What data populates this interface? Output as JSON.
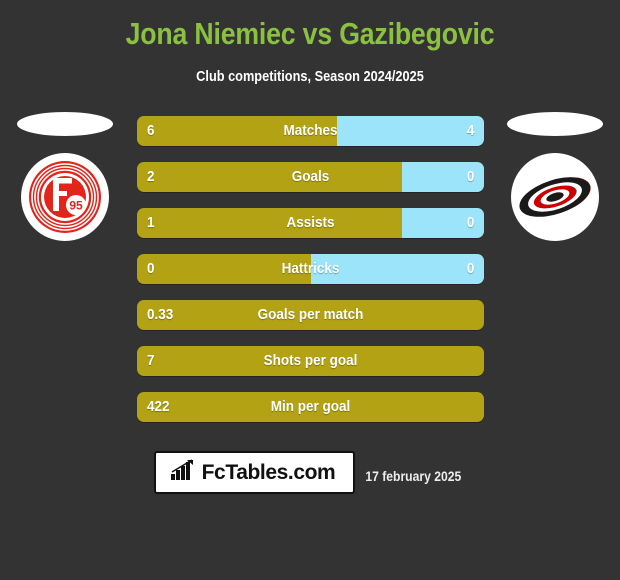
{
  "header": {
    "title": "Jona Niemiec vs Gazibegovic",
    "subtitle": "Club competitions, Season 2024/2025"
  },
  "colors": {
    "background": "#333333",
    "title_green": "#8BC141",
    "home_gold": "#B3A314",
    "away_blue": "#9BE4FA",
    "text_white": "#FFFFFF"
  },
  "teams": {
    "home": {
      "crest_name": "fortuna-dusseldorf-crest",
      "crest_text": "F",
      "crest_number": "95"
    },
    "away": {
      "crest_name": "carolina-hurricanes-crest"
    }
  },
  "stats": [
    {
      "label": "Matches",
      "home": "6",
      "away": "4",
      "home_pct": 57.5,
      "two_sided": true
    },
    {
      "label": "Goals",
      "home": "2",
      "away": "0",
      "home_pct": 76.5,
      "two_sided": true
    },
    {
      "label": "Assists",
      "home": "1",
      "away": "0",
      "home_pct": 76.5,
      "two_sided": true
    },
    {
      "label": "Hattricks",
      "home": "0",
      "away": "0",
      "home_pct": 50.0,
      "two_sided": true
    },
    {
      "label": "Goals per match",
      "home": "0.33",
      "away": "",
      "home_pct": 100,
      "two_sided": false
    },
    {
      "label": "Shots per goal",
      "home": "7",
      "away": "",
      "home_pct": 100,
      "two_sided": false
    },
    {
      "label": "Min per goal",
      "home": "422",
      "away": "",
      "home_pct": 100,
      "two_sided": false
    }
  ],
  "footer": {
    "brand_text": "FcTables.com",
    "brand_icon": "bar-chart-arrow-icon",
    "date": "17 february 2025"
  }
}
